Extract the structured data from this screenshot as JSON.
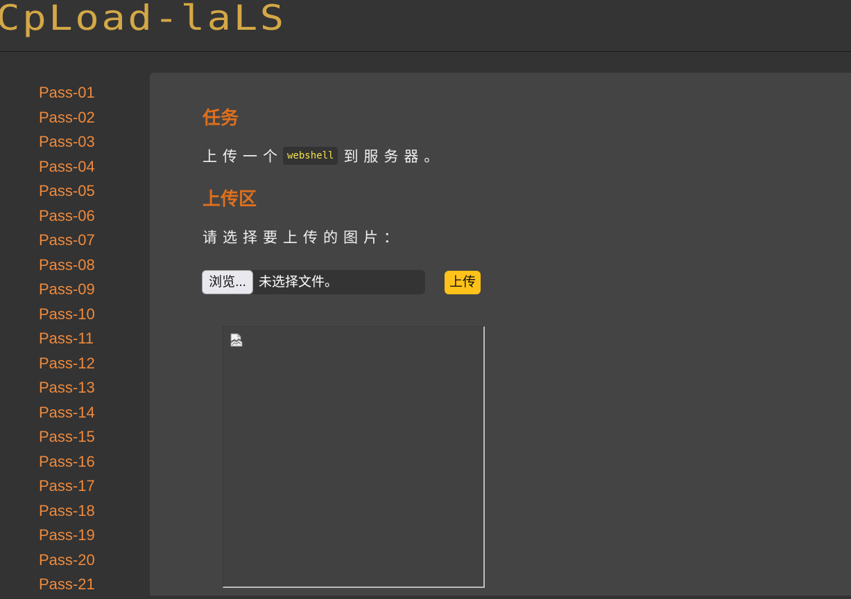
{
  "header": {
    "logo_text": "CpLoad-laLS"
  },
  "sidebar": {
    "items": [
      {
        "label": "Pass-01"
      },
      {
        "label": "Pass-02"
      },
      {
        "label": "Pass-03"
      },
      {
        "label": "Pass-04"
      },
      {
        "label": "Pass-05"
      },
      {
        "label": "Pass-06"
      },
      {
        "label": "Pass-07"
      },
      {
        "label": "Pass-08"
      },
      {
        "label": "Pass-09"
      },
      {
        "label": "Pass-10"
      },
      {
        "label": "Pass-11"
      },
      {
        "label": "Pass-12"
      },
      {
        "label": "Pass-13"
      },
      {
        "label": "Pass-14"
      },
      {
        "label": "Pass-15"
      },
      {
        "label": "Pass-16"
      },
      {
        "label": "Pass-17"
      },
      {
        "label": "Pass-18"
      },
      {
        "label": "Pass-19"
      },
      {
        "label": "Pass-20"
      },
      {
        "label": "Pass-21"
      }
    ]
  },
  "main": {
    "task_title": "任务",
    "task_prefix": "上传一个",
    "task_code": "webshell",
    "task_suffix": "到服务器。",
    "upload_title": "上传区",
    "upload_prompt": "请选择要上传的图片：",
    "browse_label": "浏览...",
    "file_status": "未选择文件。",
    "upload_button": "上传",
    "preview_icon": "broken-image-icon"
  },
  "colors": {
    "accent": "#e0701c",
    "sidebar_link": "#f08a3c",
    "logo": "#d4a846",
    "upload_button": "#ffc21a",
    "code_text": "#f2e24d",
    "panel_bg": "#444444",
    "page_bg": "#333333"
  }
}
